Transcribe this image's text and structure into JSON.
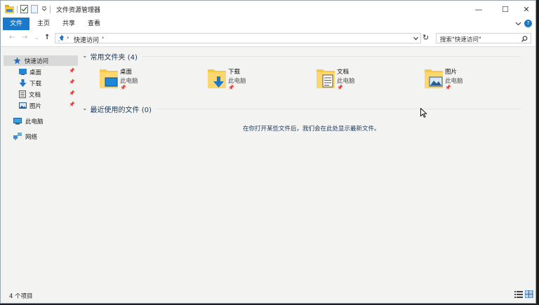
{
  "window": {
    "title": "文件资源管理器",
    "controls": {
      "minimize": "—",
      "maximize": "☐",
      "close": "✕"
    }
  },
  "ribbon": {
    "tabs": [
      "文件",
      "主页",
      "共享",
      "查看"
    ],
    "expand_icon": "chevron-down",
    "help_icon": "help"
  },
  "address": {
    "breadcrumb": "快速访问",
    "search_placeholder": "搜索\"快速访问\""
  },
  "nav": {
    "quick_access": "快速访问",
    "pinned": [
      "桌面",
      "下载",
      "文档",
      "图片"
    ],
    "this_pc": "此电脑",
    "network": "网络"
  },
  "content": {
    "frequent_header": "常用文件夹 (4)",
    "folders": [
      {
        "name": "桌面",
        "location": "此电脑",
        "icon": "desktop-folder"
      },
      {
        "name": "下载",
        "location": "此电脑",
        "icon": "download-folder"
      },
      {
        "name": "文档",
        "location": "此电脑",
        "icon": "documents-folder"
      },
      {
        "name": "图片",
        "location": "此电脑",
        "icon": "pictures-folder"
      }
    ],
    "recent_header": "最近使用的文件 (0)",
    "recent_empty": "在你打开某些文件后，我们会在此处显示最新文件。"
  },
  "status": {
    "item_count": "4 个项目"
  },
  "colors": {
    "accent": "#1979ca",
    "folder": "#f7c843",
    "header_text": "#1e395b"
  }
}
